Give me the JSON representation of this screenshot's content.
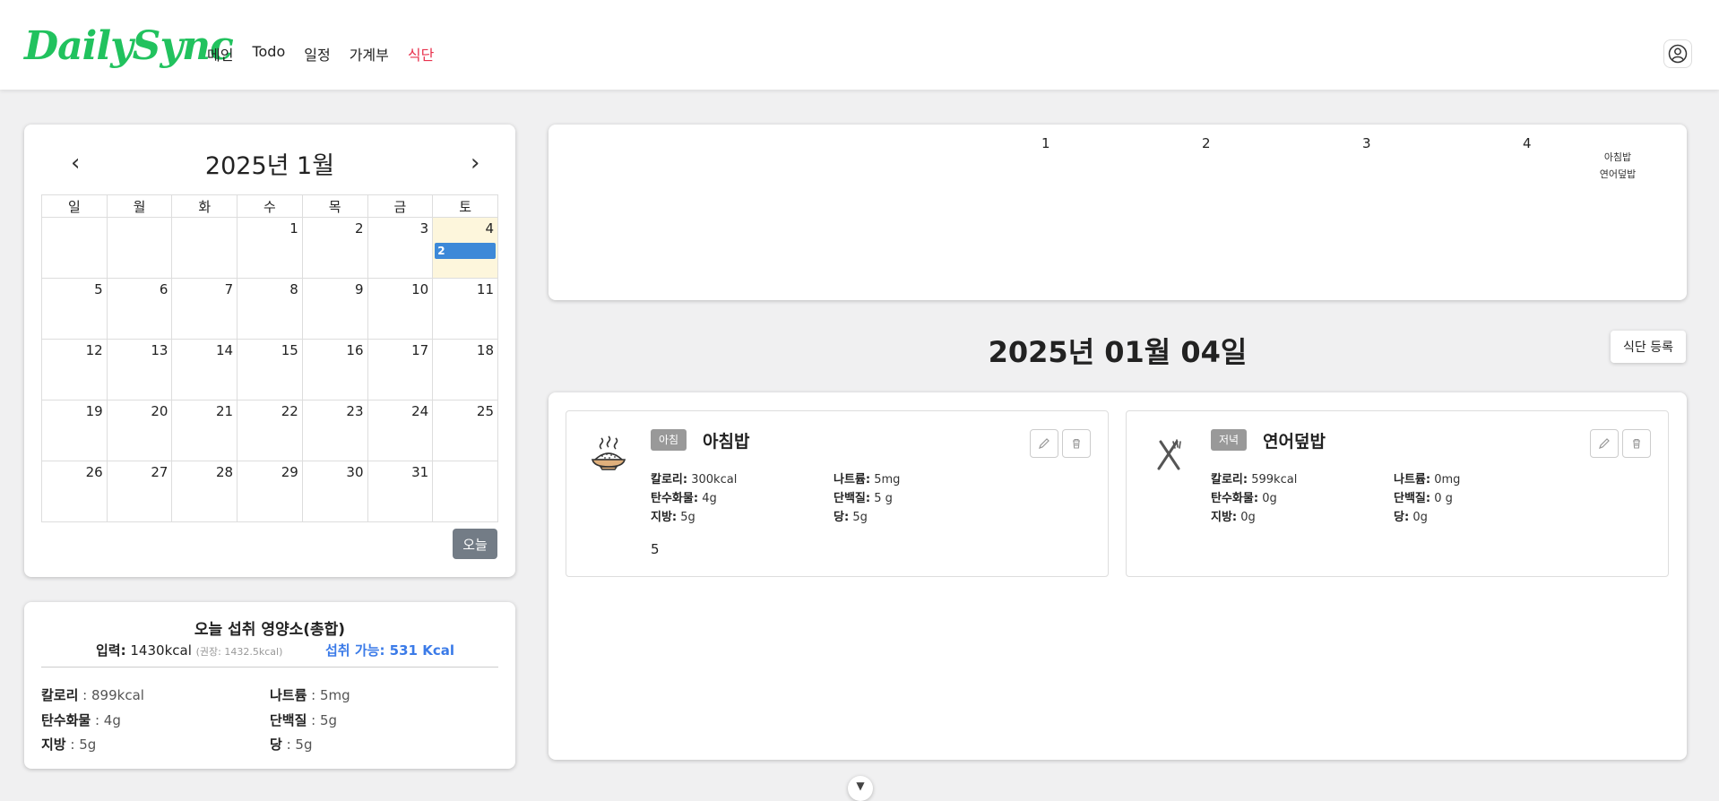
{
  "header": {
    "logo": "DailySync",
    "nav": [
      {
        "label": "메인",
        "active": false
      },
      {
        "label": "Todo",
        "active": false
      },
      {
        "label": "일정",
        "active": false
      },
      {
        "label": "가계부",
        "active": false
      },
      {
        "label": "식단",
        "active": true
      }
    ],
    "profile_icon": "user-circle-icon"
  },
  "calendar": {
    "title": "2025년 1월",
    "weekdays": [
      "일",
      "월",
      "화",
      "수",
      "목",
      "금",
      "토"
    ],
    "weeks": [
      [
        "",
        "",
        "",
        "1",
        "2",
        "3",
        "4"
      ],
      [
        "5",
        "6",
        "7",
        "8",
        "9",
        "10",
        "11"
      ],
      [
        "12",
        "13",
        "14",
        "15",
        "16",
        "17",
        "18"
      ],
      [
        "19",
        "20",
        "21",
        "22",
        "23",
        "24",
        "25"
      ],
      [
        "26",
        "27",
        "28",
        "29",
        "30",
        "31",
        ""
      ]
    ],
    "today_day": "4",
    "event": {
      "day": "4",
      "label": "2"
    },
    "today_button": "오늘",
    "colors": {
      "today_bg": "#fdf6dc",
      "event": "#3d89d8"
    }
  },
  "summary": {
    "title": "오늘 섭취 영양소(총합)",
    "input_label": "입력",
    "input_value": "1430kcal",
    "recommended": "(권장: 1432.5kcal)",
    "available_label": "섭취 가능",
    "available_value": "531 Kcal",
    "items": [
      {
        "label": "칼로리",
        "value": "899kcal"
      },
      {
        "label": "나트륨",
        "value": "5mg"
      },
      {
        "label": "탄수화물",
        "value": "4g"
      },
      {
        "label": "단백질",
        "value": "5g"
      },
      {
        "label": "지방",
        "value": "5g"
      },
      {
        "label": "당",
        "value": "5g"
      }
    ]
  },
  "week_strip": {
    "days": [
      "1",
      "2",
      "3",
      "4"
    ],
    "meals_on_4": [
      "아침밥",
      "연어덮밥"
    ]
  },
  "date_heading": "2025년 01월 04일",
  "register_button": "식단 등록",
  "meals": [
    {
      "tag": "아침",
      "name": "아침밥",
      "icon": "rice-bowl-icon",
      "nutrients": {
        "calorie": "300kcal",
        "sodium": "5mg",
        "carbs": "4g",
        "protein": "5 g",
        "fat": "5g",
        "sugar": "5g"
      },
      "note": "5"
    },
    {
      "tag": "저녁",
      "name": "연어덮밥",
      "icon": "fork-knife-icon",
      "nutrients": {
        "calorie": "599kcal",
        "sodium": "0mg",
        "carbs": "0g",
        "protein": "0 g",
        "fat": "0g",
        "sugar": "0g"
      },
      "note": ""
    }
  ],
  "nutrient_labels": {
    "calorie": "칼로리",
    "sodium": "나트륨",
    "carbs": "탄수화물",
    "protein": "단백질",
    "fat": "지방",
    "sugar": "당"
  },
  "colors": {
    "logo": "#21c25e",
    "nav_active": "#e8334e",
    "available": "#3b7be8",
    "today_btn": "#737c86",
    "meal_tag": "#999999"
  }
}
